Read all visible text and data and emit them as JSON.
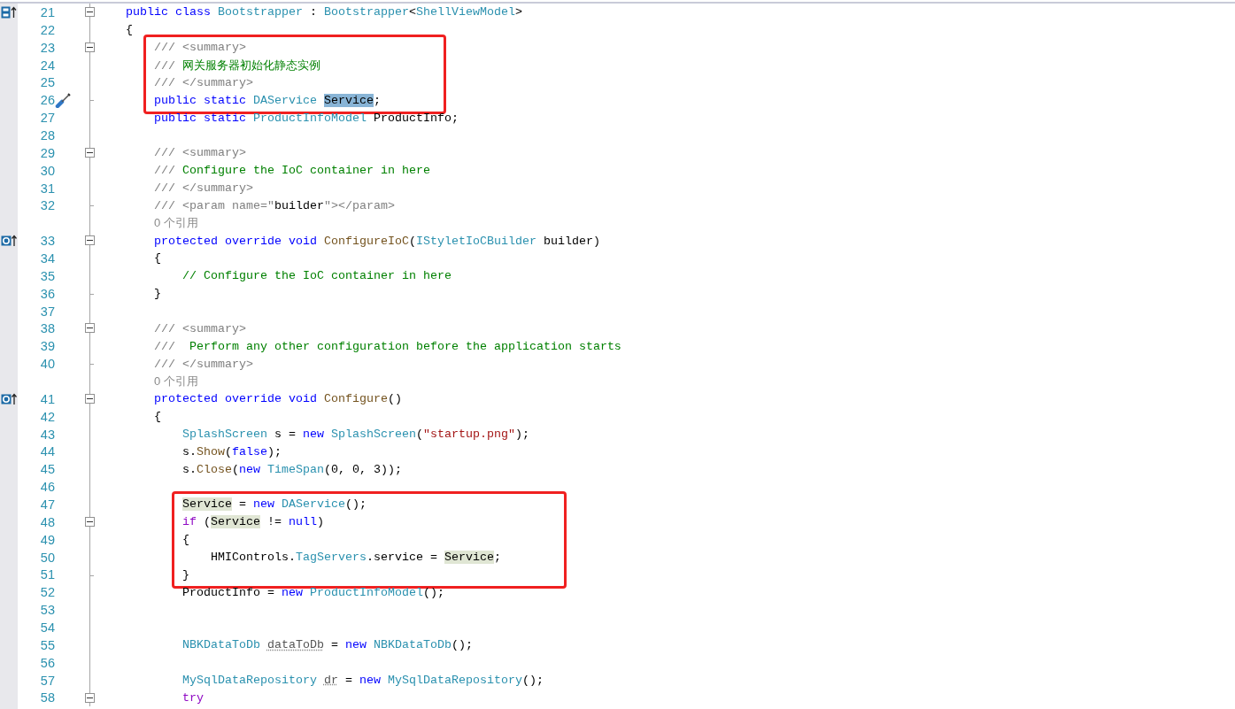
{
  "editor": {
    "blocks": [
      {
        "kind": "lines",
        "lines": [
          {
            "kind": "code",
            "number": "21",
            "implements_marker": true,
            "fold_start": true,
            "expanded": true,
            "tokens": [
              {
                "kind": "keyword",
                "text": "    public class "
              },
              {
                "kind": "type",
                "text": "Bootstrapper"
              },
              {
                "kind": "plain",
                "text": " : "
              },
              {
                "kind": "type",
                "text": "Bootstrapper"
              },
              {
                "kind": "plain",
                "text": "<"
              },
              {
                "kind": "type",
                "text": "ShellViewModel"
              },
              {
                "kind": "plain",
                "text": ">"
              }
            ]
          },
          {
            "kind": "code",
            "number": "22",
            "tokens": [
              {
                "kind": "plain",
                "text": "    {"
              }
            ]
          }
        ]
      },
      {
        "kind": "boxed",
        "lines": [
          {
            "kind": "code",
            "number": "23",
            "fold_start": true,
            "expanded": true,
            "tokens": [
              {
                "kind": "doc",
                "text": "        /// <summary>"
              }
            ]
          },
          {
            "kind": "code",
            "number": "24",
            "tokens": [
              {
                "kind": "doc",
                "text": "        /// "
              },
              {
                "kind": "comment",
                "text": "网关服务器初始化静态实例"
              }
            ]
          },
          {
            "kind": "code",
            "number": "25",
            "tokens": [
              {
                "kind": "doc",
                "text": "        /// </summary>"
              }
            ]
          },
          {
            "kind": "code",
            "number": "26",
            "fold_end": true,
            "quick_action": true,
            "tokens": [
              {
                "kind": "keyword",
                "text": "        public static "
              },
              {
                "kind": "type",
                "text": "DAService "
              },
              {
                "kind": "plain",
                "text": "Service",
                "selected": true
              },
              {
                "kind": "plain",
                "text": ";"
              }
            ]
          }
        ]
      },
      {
        "kind": "lines",
        "lines": [
          {
            "kind": "code",
            "number": "27",
            "tokens": [
              {
                "kind": "keyword",
                "text": "        public static "
              },
              {
                "kind": "type",
                "text": "ProductInfoModel"
              },
              {
                "kind": "plain",
                "text": " ProductInfo;"
              }
            ]
          },
          {
            "kind": "code",
            "number": "28"
          },
          {
            "kind": "code",
            "number": "29",
            "fold_start": true,
            "expanded": true,
            "tokens": [
              {
                "kind": "doc",
                "text": "        /// <summary>"
              }
            ]
          },
          {
            "kind": "code",
            "number": "30",
            "tokens": [
              {
                "kind": "doc",
                "text": "        /// "
              },
              {
                "kind": "comment",
                "text": "Configure the IoC container in here"
              }
            ]
          },
          {
            "kind": "code",
            "number": "31",
            "tokens": [
              {
                "kind": "doc",
                "text": "        /// </summary>"
              }
            ]
          },
          {
            "kind": "code",
            "number": "32",
            "fold_end": true,
            "tokens": [
              {
                "kind": "doc",
                "text": "        /// <param name=\""
              },
              {
                "kind": "plain",
                "text": "builder"
              },
              {
                "kind": "doc",
                "text": "\"></param>"
              }
            ]
          },
          {
            "kind": "codelens",
            "tokens": [
              {
                "kind": "lens",
                "text": "0 个引用"
              }
            ]
          },
          {
            "kind": "code",
            "number": "33",
            "override_marker": true,
            "fold_start": true,
            "expanded": true,
            "tokens": [
              {
                "kind": "keyword",
                "text": "        protected override void "
              },
              {
                "kind": "method",
                "text": "ConfigureIoC"
              },
              {
                "kind": "plain",
                "text": "("
              },
              {
                "kind": "type",
                "text": "IStyletIoCBuilder"
              },
              {
                "kind": "plain",
                "text": " builder)"
              }
            ]
          },
          {
            "kind": "code",
            "number": "34",
            "tokens": [
              {
                "kind": "plain",
                "text": "        {"
              }
            ]
          },
          {
            "kind": "code",
            "number": "35",
            "tokens": [
              {
                "kind": "comment",
                "text": "            // Configure the IoC container in here"
              }
            ]
          },
          {
            "kind": "code",
            "number": "36",
            "fold_end": true,
            "tokens": [
              {
                "kind": "plain",
                "text": "        }"
              }
            ]
          },
          {
            "kind": "code",
            "number": "37"
          },
          {
            "kind": "code",
            "number": "38",
            "fold_start": true,
            "expanded": true,
            "tokens": [
              {
                "kind": "doc",
                "text": "        /// <summary>"
              }
            ]
          },
          {
            "kind": "code",
            "number": "39",
            "tokens": [
              {
                "kind": "doc",
                "text": "        /// "
              },
              {
                "kind": "comment",
                "text": " Perform any other configuration before the application starts"
              }
            ]
          },
          {
            "kind": "code",
            "number": "40",
            "fold_end": true,
            "tokens": [
              {
                "kind": "doc",
                "text": "        /// </summary>"
              }
            ]
          },
          {
            "kind": "codelens",
            "tokens": [
              {
                "kind": "lens",
                "text": "0 个引用"
              }
            ]
          },
          {
            "kind": "code",
            "number": "41",
            "override_marker": true,
            "fold_start": true,
            "expanded": true,
            "tokens": [
              {
                "kind": "keyword",
                "text": "        protected override void "
              },
              {
                "kind": "method",
                "text": "Configure"
              },
              {
                "kind": "plain",
                "text": "()"
              }
            ]
          },
          {
            "kind": "code",
            "number": "42",
            "tokens": [
              {
                "kind": "plain",
                "text": "        {"
              }
            ]
          },
          {
            "kind": "code",
            "number": "43",
            "tokens": [
              {
                "kind": "type",
                "text": "            SplashScreen"
              },
              {
                "kind": "plain",
                "text": " s = "
              },
              {
                "kind": "keyword",
                "text": "new "
              },
              {
                "kind": "type",
                "text": "SplashScreen"
              },
              {
                "kind": "plain",
                "text": "("
              },
              {
                "kind": "string",
                "text": "\"startup.png\""
              },
              {
                "kind": "plain",
                "text": ");"
              }
            ]
          },
          {
            "kind": "code",
            "number": "44",
            "tokens": [
              {
                "kind": "plain",
                "text": "            s."
              },
              {
                "kind": "method",
                "text": "Show"
              },
              {
                "kind": "plain",
                "text": "("
              },
              {
                "kind": "keyword",
                "text": "false"
              },
              {
                "kind": "plain",
                "text": ");"
              }
            ]
          },
          {
            "kind": "code",
            "number": "45",
            "tokens": [
              {
                "kind": "plain",
                "text": "            s."
              },
              {
                "kind": "method",
                "text": "Close"
              },
              {
                "kind": "plain",
                "text": "("
              },
              {
                "kind": "keyword",
                "text": "new "
              },
              {
                "kind": "type",
                "text": "TimeSpan"
              },
              {
                "kind": "plain",
                "text": "(0, 0, 3));"
              }
            ]
          },
          {
            "kind": "code",
            "number": "46"
          }
        ]
      },
      {
        "kind": "boxed",
        "lines": [
          {
            "kind": "code",
            "number": "47",
            "tokens": [
              {
                "kind": "plain",
                "text": "            Service",
                "referenced": true
              },
              {
                "kind": "plain",
                "text": " = "
              },
              {
                "kind": "keyword",
                "text": "new "
              },
              {
                "kind": "type",
                "text": "DAService"
              },
              {
                "kind": "plain",
                "text": "();"
              }
            ]
          },
          {
            "kind": "code",
            "number": "48",
            "fold_start": true,
            "expanded": true,
            "tokens": [
              {
                "kind": "control",
                "text": "            if"
              },
              {
                "kind": "plain",
                "text": " ("
              },
              {
                "kind": "plain",
                "text": "Service",
                "referenced": true
              },
              {
                "kind": "plain",
                "text": " != "
              },
              {
                "kind": "keyword",
                "text": "null"
              },
              {
                "kind": "plain",
                "text": ")"
              }
            ]
          },
          {
            "kind": "code",
            "number": "49",
            "tokens": [
              {
                "kind": "plain",
                "text": "            {"
              }
            ]
          },
          {
            "kind": "code",
            "number": "50",
            "tokens": [
              {
                "kind": "plain",
                "text": "                HMIControls."
              },
              {
                "kind": "type",
                "text": "TagServers"
              },
              {
                "kind": "plain",
                "text": ".service = "
              },
              {
                "kind": "plain",
                "text": "Service",
                "referenced": true
              },
              {
                "kind": "plain",
                "text": ";"
              }
            ]
          },
          {
            "kind": "code",
            "number": "51",
            "fold_end": true,
            "tokens": [
              {
                "kind": "plain",
                "text": "            }"
              }
            ]
          }
        ]
      },
      {
        "kind": "lines",
        "lines": [
          {
            "kind": "code",
            "number": "52",
            "tokens": [
              {
                "kind": "plain",
                "text": "            ProductInfo = "
              },
              {
                "kind": "keyword",
                "text": "new "
              },
              {
                "kind": "type",
                "text": "ProductInfoModel"
              },
              {
                "kind": "plain",
                "text": "();"
              }
            ]
          },
          {
            "kind": "code",
            "number": "53"
          },
          {
            "kind": "code",
            "number": "54"
          },
          {
            "kind": "code",
            "number": "55",
            "tokens": [
              {
                "kind": "type",
                "text": "            NBKDataToDb "
              },
              {
                "kind": "unused",
                "text": "dataToDb"
              },
              {
                "kind": "plain",
                "text": " = "
              },
              {
                "kind": "keyword",
                "text": "new "
              },
              {
                "kind": "type",
                "text": "NBKDataToDb"
              },
              {
                "kind": "plain",
                "text": "();"
              }
            ]
          },
          {
            "kind": "code",
            "number": "56"
          },
          {
            "kind": "code",
            "number": "57",
            "tokens": [
              {
                "kind": "type",
                "text": "            MySqlDataRepository "
              },
              {
                "kind": "unused",
                "text": "dr"
              },
              {
                "kind": "plain",
                "text": " = "
              },
              {
                "kind": "keyword",
                "text": "new "
              },
              {
                "kind": "type",
                "text": "MySqlDataRepository"
              },
              {
                "kind": "plain",
                "text": "();"
              }
            ]
          },
          {
            "kind": "code",
            "number": "58",
            "fold_start": true,
            "expanded": true,
            "tokens": [
              {
                "kind": "control",
                "text": "            try"
              }
            ]
          }
        ]
      }
    ]
  }
}
